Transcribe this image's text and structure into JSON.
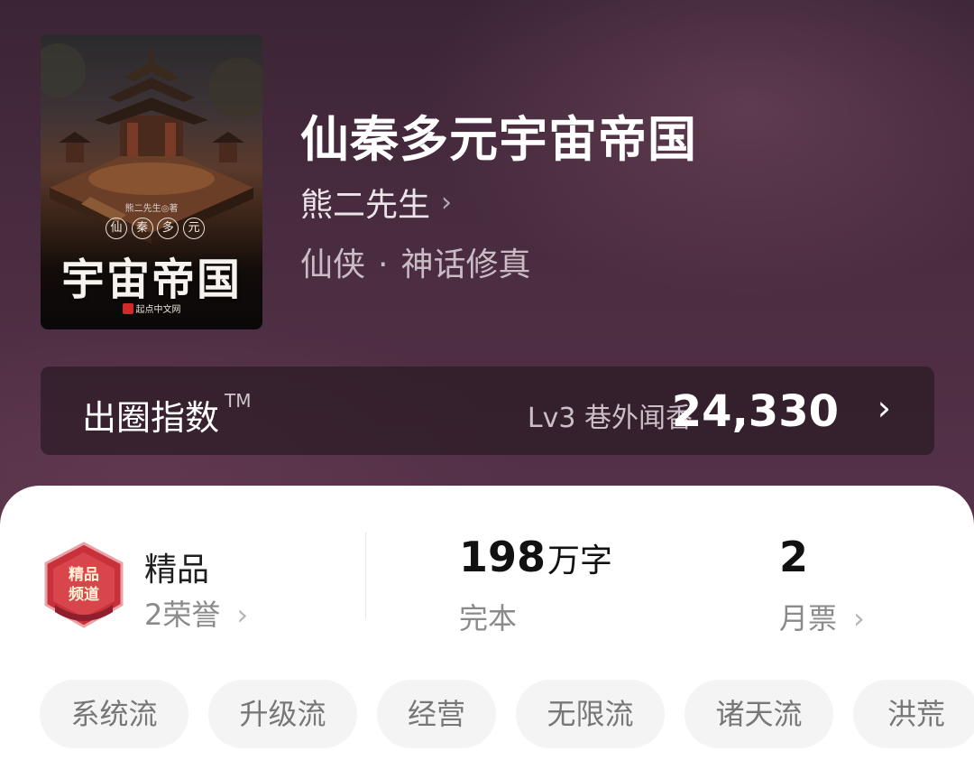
{
  "book": {
    "title": "仙秦多元宇宙帝国",
    "author": "熊二先生",
    "author_chevron": "›",
    "genre_main": "仙侠",
    "genre_separator": "·",
    "genre_sub": "神话修真",
    "cover": {
      "author_mark": "熊二先生◎著",
      "small_title": [
        "仙",
        "秦",
        "多",
        "元"
      ],
      "big_title": "宇宙帝国",
      "publisher": "起点中文网"
    }
  },
  "index_card": {
    "label": "出圈指数",
    "tm": "TM",
    "level": "Lv3 巷外闻香",
    "score": "24,330",
    "arrow": "›"
  },
  "stats": {
    "badge": {
      "icon": "boutique-channel-badge-icon",
      "icon_text": "精品频道",
      "title": "精品",
      "sub": "2荣誉",
      "chevron": "›"
    },
    "words": {
      "number": "198",
      "unit": "万字",
      "status": "完本"
    },
    "monthly_ticket": {
      "number": "2",
      "label": "月票",
      "chevron": "›"
    }
  },
  "tags": [
    "系统流",
    "升级流",
    "经营",
    "无限流",
    "诸天流",
    "洪荒"
  ],
  "colors": {
    "hero_bg": "#4a2c40",
    "index_card_bg": "#23161f",
    "badge_red": "#c8303a",
    "tag_bg": "#f4f4f4"
  }
}
